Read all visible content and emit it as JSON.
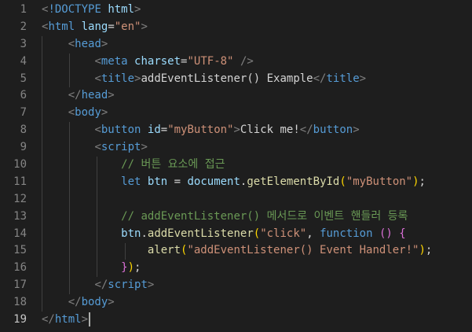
{
  "editor": {
    "line_numbers": [
      "1",
      "2",
      "3",
      "4",
      "5",
      "6",
      "7",
      "8",
      "9",
      "10",
      "11",
      "12",
      "13",
      "14",
      "15",
      "16",
      "17",
      "18",
      "19"
    ],
    "active_line": 19,
    "theme_colors": {
      "background": "#1e1e1e",
      "tag": "#569cd6",
      "attribute": "#9cdcfe",
      "string": "#ce9178",
      "function": "#dcdcaa",
      "comment": "#6a9955",
      "punctuation": "#808080"
    },
    "lines": [
      [
        [
          "t-punc",
          "<"
        ],
        [
          "t-tag",
          "!DOCTYPE"
        ],
        [
          "t-plain",
          " "
        ],
        [
          "t-attr",
          "html"
        ],
        [
          "t-punc",
          ">"
        ]
      ],
      [
        [
          "t-punc",
          "<"
        ],
        [
          "t-tag",
          "html"
        ],
        [
          "t-plain",
          " "
        ],
        [
          "t-attr",
          "lang"
        ],
        [
          "t-plain",
          "="
        ],
        [
          "t-str",
          "\"en\""
        ],
        [
          "t-punc",
          ">"
        ]
      ],
      [
        [
          "t-plain",
          "    "
        ],
        [
          "t-punc",
          "<"
        ],
        [
          "t-tag",
          "head"
        ],
        [
          "t-punc",
          ">"
        ]
      ],
      [
        [
          "t-plain",
          "        "
        ],
        [
          "t-punc",
          "<"
        ],
        [
          "t-tag",
          "meta"
        ],
        [
          "t-plain",
          " "
        ],
        [
          "t-attr",
          "charset"
        ],
        [
          "t-plain",
          "="
        ],
        [
          "t-str",
          "\"UTF-8\""
        ],
        [
          "t-plain",
          " "
        ],
        [
          "t-punc",
          "/>"
        ]
      ],
      [
        [
          "t-plain",
          "        "
        ],
        [
          "t-punc",
          "<"
        ],
        [
          "t-tag",
          "title"
        ],
        [
          "t-punc",
          ">"
        ],
        [
          "t-text",
          "addEventListener() Example"
        ],
        [
          "t-punc",
          "</"
        ],
        [
          "t-tag",
          "title"
        ],
        [
          "t-punc",
          ">"
        ]
      ],
      [
        [
          "t-plain",
          "    "
        ],
        [
          "t-punc",
          "</"
        ],
        [
          "t-tag",
          "head"
        ],
        [
          "t-punc",
          ">"
        ]
      ],
      [
        [
          "t-plain",
          "    "
        ],
        [
          "t-punc",
          "<"
        ],
        [
          "t-tag",
          "body"
        ],
        [
          "t-punc",
          ">"
        ]
      ],
      [
        [
          "t-plain",
          "        "
        ],
        [
          "t-punc",
          "<"
        ],
        [
          "t-tag",
          "button"
        ],
        [
          "t-plain",
          " "
        ],
        [
          "t-attr",
          "id"
        ],
        [
          "t-plain",
          "="
        ],
        [
          "t-str",
          "\"myButton\""
        ],
        [
          "t-punc",
          ">"
        ],
        [
          "t-text",
          "Click me!"
        ],
        [
          "t-punc",
          "</"
        ],
        [
          "t-tag",
          "button"
        ],
        [
          "t-punc",
          ">"
        ]
      ],
      [
        [
          "t-plain",
          "        "
        ],
        [
          "t-punc",
          "<"
        ],
        [
          "t-tag",
          "script"
        ],
        [
          "t-punc",
          ">"
        ]
      ],
      [
        [
          "t-plain",
          "            "
        ],
        [
          "t-com",
          "// 버튼 요소에 접근"
        ]
      ],
      [
        [
          "t-plain",
          "            "
        ],
        [
          "t-kw",
          "let"
        ],
        [
          "t-plain",
          " "
        ],
        [
          "t-var",
          "btn"
        ],
        [
          "t-plain",
          " = "
        ],
        [
          "t-var",
          "document"
        ],
        [
          "t-plain",
          "."
        ],
        [
          "t-fn",
          "getElementById"
        ],
        [
          "t-brk1",
          "("
        ],
        [
          "t-str",
          "\"myButton\""
        ],
        [
          "t-brk1",
          ")"
        ],
        [
          "t-plain",
          ";"
        ]
      ],
      [
        [
          "t-plain",
          ""
        ]
      ],
      [
        [
          "t-plain",
          "            "
        ],
        [
          "t-com",
          "// addEventListener() 메서드로 이벤트 핸들러 등록"
        ]
      ],
      [
        [
          "t-plain",
          "            "
        ],
        [
          "t-var",
          "btn"
        ],
        [
          "t-plain",
          "."
        ],
        [
          "t-fn",
          "addEventListener"
        ],
        [
          "t-brk1",
          "("
        ],
        [
          "t-str",
          "\"click\""
        ],
        [
          "t-plain",
          ", "
        ],
        [
          "t-kw",
          "function"
        ],
        [
          "t-plain",
          " "
        ],
        [
          "t-brk2",
          "()"
        ],
        [
          "t-plain",
          " "
        ],
        [
          "t-brk2",
          "{"
        ]
      ],
      [
        [
          "t-plain",
          "                "
        ],
        [
          "t-fn",
          "alert"
        ],
        [
          "t-brk1",
          "("
        ],
        [
          "t-str",
          "\"addEventListener() Event Handler!\""
        ],
        [
          "t-brk1",
          ")"
        ],
        [
          "t-plain",
          ";"
        ]
      ],
      [
        [
          "t-plain",
          "            "
        ],
        [
          "t-brk2",
          "}"
        ],
        [
          "t-brk1",
          ")"
        ],
        [
          "t-plain",
          ";"
        ]
      ],
      [
        [
          "t-plain",
          "        "
        ],
        [
          "t-punc",
          "</"
        ],
        [
          "t-tag",
          "script"
        ],
        [
          "t-punc",
          ">"
        ]
      ],
      [
        [
          "t-plain",
          "    "
        ],
        [
          "t-punc",
          "</"
        ],
        [
          "t-tag",
          "body"
        ],
        [
          "t-punc",
          ">"
        ]
      ],
      [
        [
          "t-punc",
          "</"
        ],
        [
          "t-tag",
          "html"
        ],
        [
          "t-punc",
          ">"
        ]
      ]
    ]
  }
}
